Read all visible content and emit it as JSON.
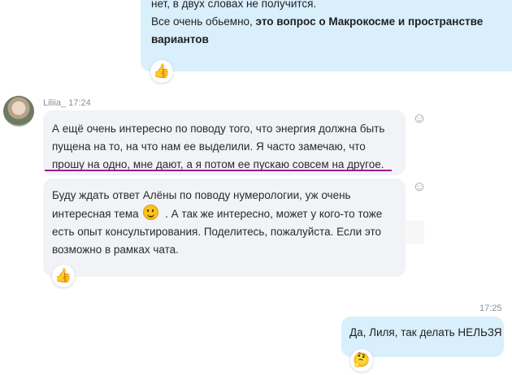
{
  "chat": {
    "message_prev": {
      "line1": "нет, в двух словах не получится.",
      "line2_plain": "Все очень обьемно, ",
      "line2_bold": "это вопрос о Макрокосме и пространстве",
      "line3_bold": "вариантов",
      "reaction": "👍"
    },
    "incoming": {
      "sender_header": "Liliia_  17:24",
      "message1": {
        "line1": "А ещё очень интересно по поводу того, что энергия должна быть",
        "line2": "пущена на то, на что нам ее выделили. Я часто замечаю, что",
        "line3": "прошу на одно, мне дают, а я потом ее пускаю  совсем на другое.",
        "react_icon": "☺"
      },
      "message2": {
        "line1": "Буду ждать ответ Алёны по поводу нумерологии, уж очень",
        "line2a": "интересная тема",
        "line2b": " . А так же интересно, может у кого-то тоже",
        "line3": "есть опыт консультирования. Поделитесь, пожалуйста. Если это",
        "line4": "возможно в рамках чата.",
        "react_icon": "☺",
        "reaction": "👍"
      }
    },
    "outgoing": {
      "time": "17:25",
      "text": "Да, Лиля, так делать НЕЛЬЗЯ",
      "reaction": "🤔"
    }
  }
}
